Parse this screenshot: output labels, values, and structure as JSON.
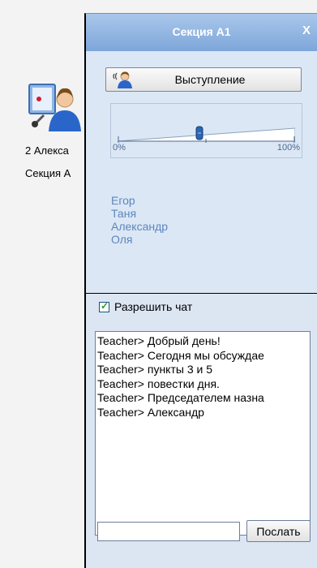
{
  "desktop": {
    "icon": "presenter-monitor-icon",
    "label_line1": "2 Алекса",
    "label_line2": "Секция А"
  },
  "panel": {
    "title": "Секция А1",
    "close_label": "X",
    "speak_button": {
      "label": "Выступление",
      "icon": "speaker-person-icon"
    },
    "volume": {
      "min_label": "0%",
      "max_label": "100%",
      "value_percent": 46
    },
    "participants": [
      "Егор",
      "Таня",
      "Александр",
      "Оля"
    ],
    "allow_chat": {
      "label": "Разрешить чат",
      "checked": true
    },
    "chat_lines": [
      "Teacher> Добрый день!",
      "Teacher> Сегодня мы обсуждае",
      "Teacher> пункты 3 и 5",
      "Teacher> повестки дня.",
      "Teacher> Председателем назна",
      "Teacher> Александр"
    ],
    "message_input": {
      "value": ""
    },
    "send_label": "Послать",
    "colors": {
      "header": "#7ea6da",
      "panel_bg": "#dbe7f4",
      "participant_text": "#5d86bf"
    }
  }
}
